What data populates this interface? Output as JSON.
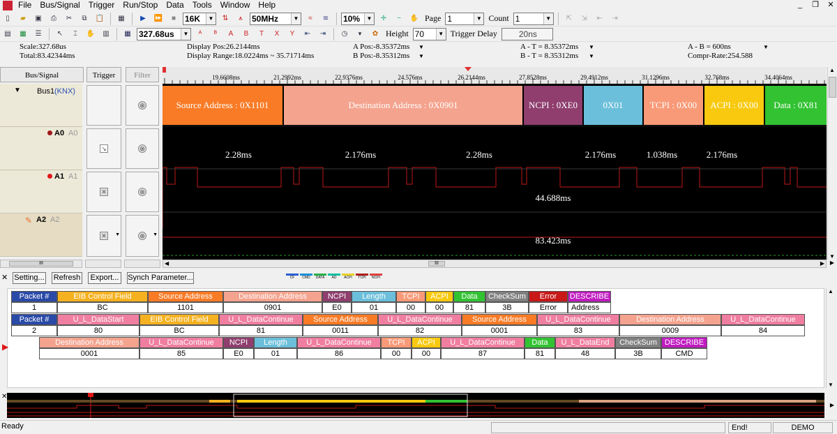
{
  "menu": [
    "File",
    "Bus/Signal",
    "Trigger",
    "Run/Stop",
    "Data",
    "Tools",
    "Window",
    "Help"
  ],
  "toolbar1": {
    "sample_depth": "16K",
    "sample_rate": "50MHz",
    "zoom": "10%",
    "page_label": "Page",
    "page_value": "1",
    "count_label": "Count",
    "count_value": "1"
  },
  "toolbar2": {
    "time_value": "327.68us",
    "height_label": "Height",
    "height_value": "70",
    "trigger_delay_label": "Trigger Delay",
    "trigger_delay_value": "20ns"
  },
  "info": {
    "scale": "Scale:327.68us",
    "total": "Total:83.42344ms",
    "display_pos": "Display Pos:26.2144ms",
    "display_range": "Display Range:18.0224ms ~ 35.71714ms",
    "a_pos": "A Pos:-8.35372ms",
    "b_pos": "B Pos:-8.35312ms",
    "a_t": "A - T = 8.35372ms",
    "b_t": "B - T = 8.35312ms",
    "a_b": "A - B = 600ns",
    "compr": "Compr-Rate:254.588"
  },
  "columns": {
    "bus": "Bus/Signal",
    "trigger": "Trigger",
    "filter": "Filter"
  },
  "signals": [
    {
      "name": "Bus1",
      "tag": "(KNX)"
    },
    {
      "name": "A0",
      "tag": "A0"
    },
    {
      "name": "A1",
      "tag": "A1"
    },
    {
      "name": "A2",
      "tag": "A2"
    }
  ],
  "ruler": [
    "19.6608ms",
    "21.2992ms",
    "22.9376ms",
    "24.576ms",
    "26.2144ms",
    "27.8528ms",
    "29.4912ms",
    "31.1296ms",
    "32.768ms",
    "34.4064ms"
  ],
  "bus_segments": [
    {
      "label": "Source Address : 0X1101",
      "color": "#f97b26"
    },
    {
      "label": "Destination Address : 0X0901",
      "color": "#f4a38e"
    },
    {
      "label": "NCPI : 0XE0",
      "color": "#8f3e6e"
    },
    {
      "label": "0X01",
      "color": "#6bbfda"
    },
    {
      "label": "TCPI : 0X00",
      "color": "#f89a78"
    },
    {
      "label": "ACPI : 0X00",
      "color": "#f8c90f"
    },
    {
      "label": "Data : 0X81",
      "color": "#32c232"
    }
  ],
  "a0_labels": [
    "2.28ms",
    "2.176ms",
    "2.28ms",
    "2.176ms",
    "1.038ms",
    "2.176ms"
  ],
  "a1_label": "44.688ms",
  "a2_label": "83.423ms",
  "buttons": {
    "setting": "Setting...",
    "refresh": "Refresh",
    "export": "Export...",
    "synch": "Synch Parameter..."
  },
  "legend": [
    "CF",
    "CMD",
    "DATA",
    "AD",
    "ACPI",
    "TCPI",
    "NCPI"
  ],
  "packets": {
    "row1_headers": [
      "Packet #",
      "EIB Control Field",
      "Source Address",
      "Destination Address",
      "NCPI",
      "Length",
      "TCPI",
      "ACPI",
      "Data",
      "CheckSum",
      "Error",
      "DESCRIBE"
    ],
    "row1_values": [
      "1",
      "BC",
      "1101",
      "0901",
      "E0",
      "01",
      "00",
      "00",
      "81",
      "3B",
      "Error",
      "Address"
    ],
    "row2_headers": [
      "Packet #",
      "U_L_DataStart",
      "EIB Control Field",
      "U_L_DataContinue",
      "Source Address",
      "U_L_DataContinue",
      "Source Address",
      "U_L_DataContinue",
      "Destination Address",
      "U_L_DataContinue"
    ],
    "row2_values": [
      "2",
      "80",
      "BC",
      "81",
      "0011",
      "82",
      "0001",
      "83",
      "0009",
      "84"
    ],
    "row3_headers": [
      "Destination Address",
      "U_L_DataContinue",
      "NCPI",
      "Length",
      "U_L_DataContinue",
      "TCPI",
      "ACPI",
      "U_L_DataContinue",
      "Data",
      "U_L_DataEnd",
      "CheckSum",
      "DESCRIBE"
    ],
    "row3_values": [
      "0001",
      "85",
      "E0",
      "01",
      "86",
      "00",
      "00",
      "87",
      "81",
      "48",
      "3B",
      "CMD"
    ]
  },
  "status": {
    "ready": "Ready",
    "end": "End!",
    "mode": "DEMO"
  }
}
